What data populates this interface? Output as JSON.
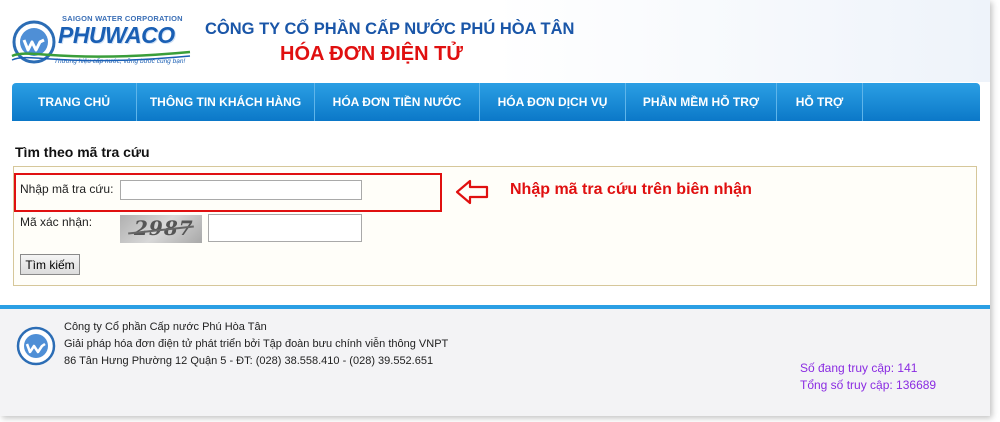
{
  "header": {
    "brand_small": "SAIGON WATER CORPORATION",
    "brand_name": "PHUWACO",
    "brand_slogan": "Thương hiệu cấp nước, vững bước cùng bạn!",
    "company_title": "CÔNG TY CỔ PHẦN CẤP NƯỚC PHÚ HÒA TÂN",
    "invoice_title": "HÓA ĐƠN ĐIỆN TỬ"
  },
  "nav": {
    "items": [
      {
        "label": "TRANG CHỦ"
      },
      {
        "label": "THÔNG TIN KHÁCH HÀNG"
      },
      {
        "label": "HÓA ĐƠN TIỀN NƯỚC"
      },
      {
        "label": "HÓA ĐƠN DỊCH VỤ"
      },
      {
        "label": "PHẦN MỀM HỖ TRỢ"
      },
      {
        "label": "HỖ TRỢ"
      }
    ]
  },
  "form": {
    "section_title": "Tìm theo mã tra cứu",
    "lookup_label": "Nhập mã tra cứu:",
    "lookup_value": "",
    "captcha_label": "Mã xác nhận:",
    "captcha_text": "2987",
    "captcha_value": "",
    "submit_label": "Tìm kiếm"
  },
  "annotation": {
    "text": "Nhập mã tra cứu trên biên nhận",
    "color": "#e01010"
  },
  "footer": {
    "line1": "Công ty Cổ phần Cấp nước Phú Hòa Tân",
    "line2": "Giải pháp hóa đơn điện tử phát triển bởi Tập đoàn bưu chính viễn thông VNPT",
    "line3": "86 Tân Hưng Phường 12 Quận 5 - ĐT: (028) 38.558.410 - (028) 39.552.651",
    "online_label": "Số đang truy cập: 141",
    "total_label": "Tổng số truy cập: 136689"
  },
  "colors": {
    "nav_bg": "#0b78c8",
    "brand_blue": "#1a56a8",
    "title_red": "#e01010",
    "stats_purple": "#8a2be2"
  }
}
